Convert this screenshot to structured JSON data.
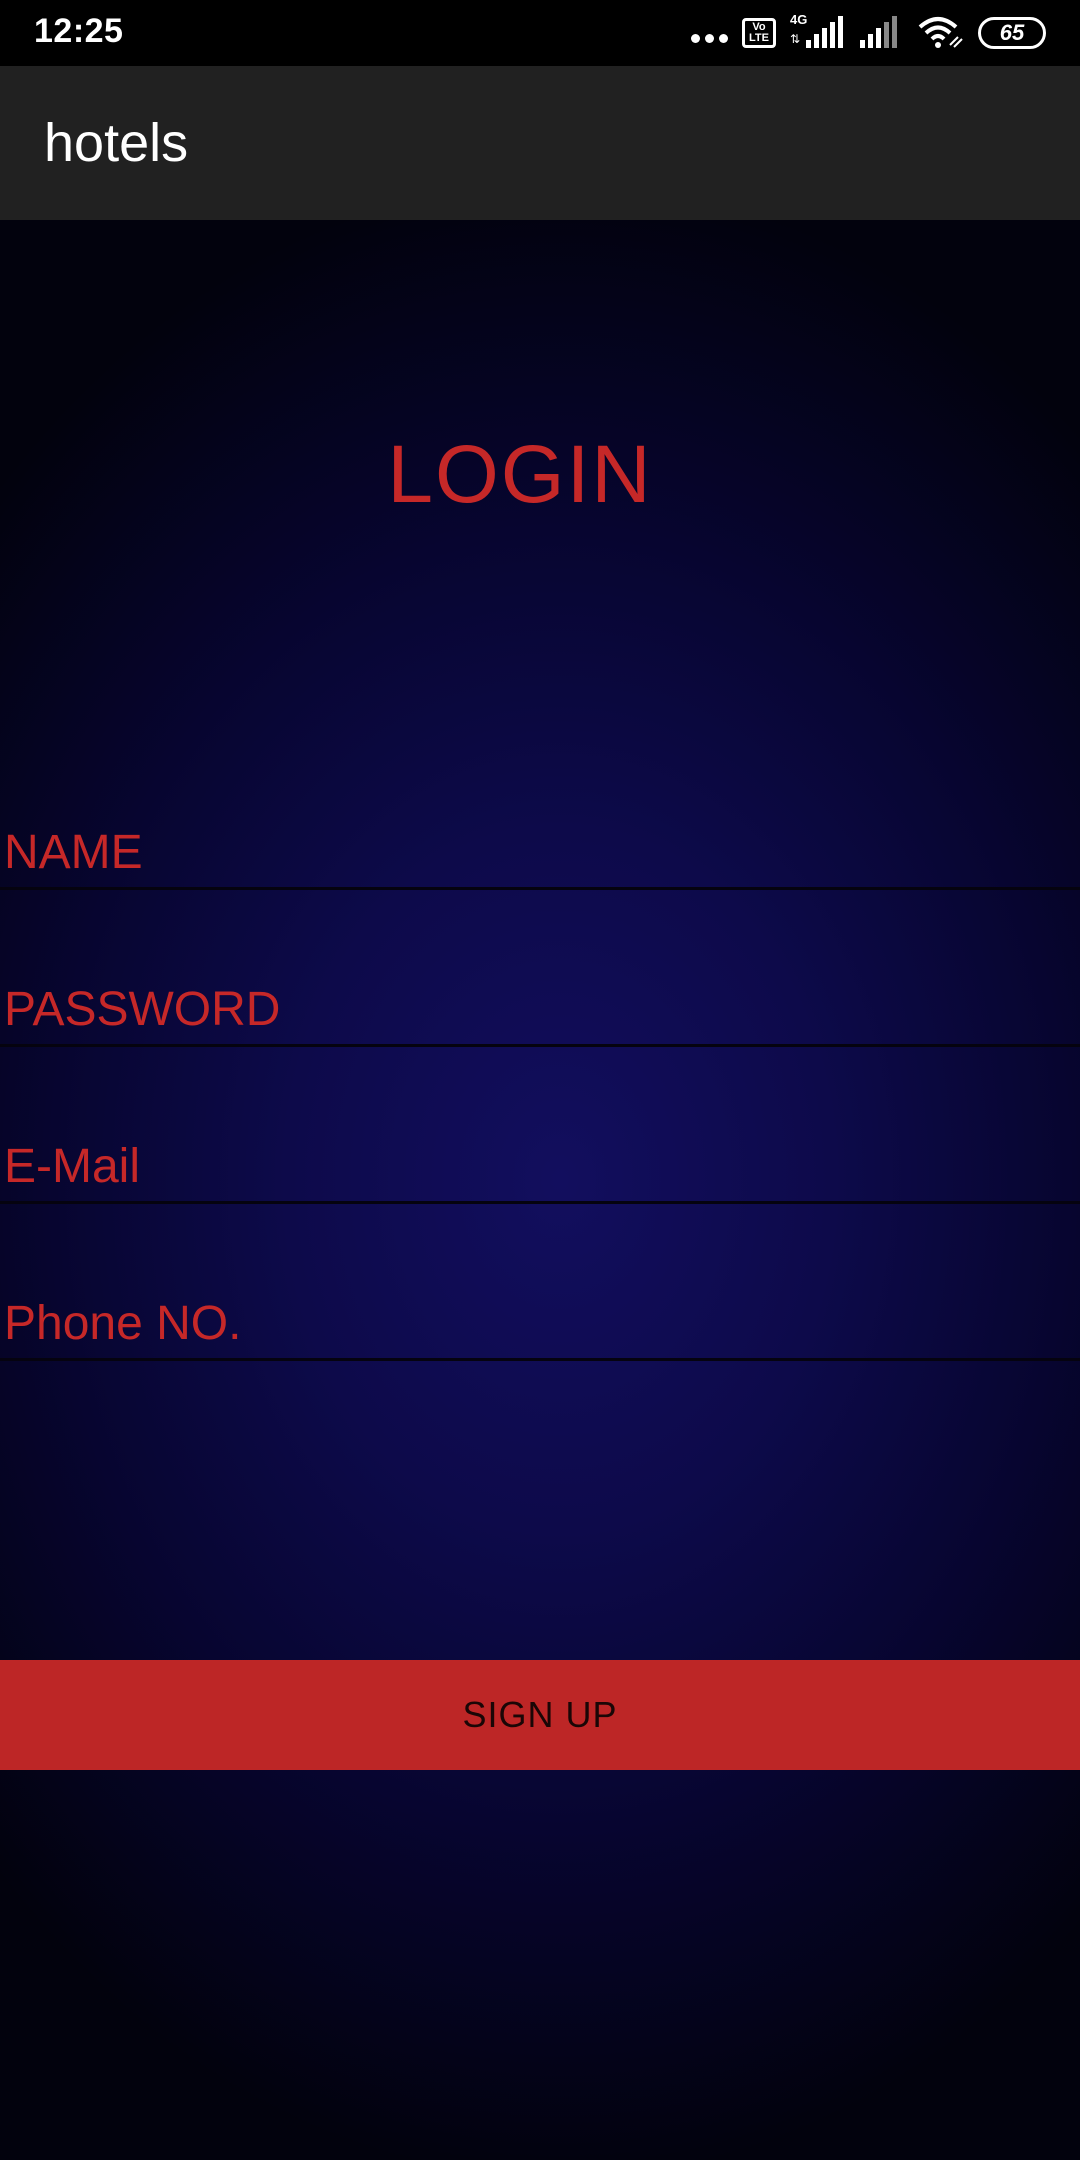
{
  "status_bar": {
    "time": "12:25",
    "network_type": "4G",
    "volte_label": "Vo LTE",
    "battery_level": "65",
    "icons": [
      "more-dots-icon",
      "volte-icon",
      "signal-4g-icon",
      "signal-icon",
      "wifi-icon",
      "battery-icon"
    ]
  },
  "app_bar": {
    "title": "hotels"
  },
  "login": {
    "heading": "LOGIN",
    "fields": {
      "name_placeholder": "NAME",
      "password_placeholder": "PASSWORD",
      "email_placeholder": "E-Mail",
      "phone_placeholder": "Phone NO."
    },
    "signup_label": "SIGN UP"
  },
  "colors": {
    "accent_red": "#c62828",
    "button_red": "#bd2626",
    "app_bar": "#212121",
    "background_center": "#120e5e",
    "background_edge": "#02020d"
  }
}
